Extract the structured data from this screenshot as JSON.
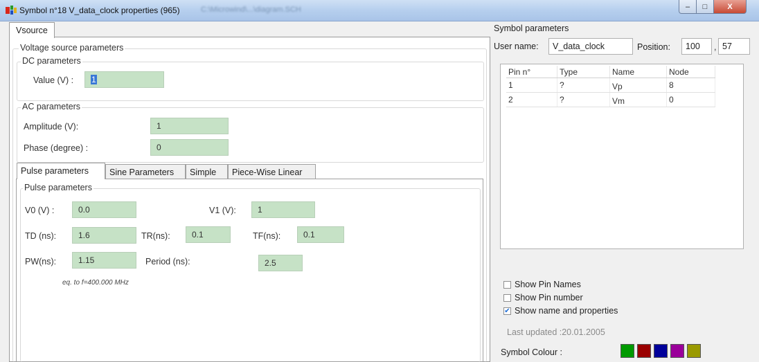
{
  "window": {
    "title": "Symbol n°18 V_data_clock properties (965)",
    "title_blurred_suffix": "C:\\Microwind\\...\\diagram.SCH",
    "min": "–",
    "max": "□",
    "close": "X"
  },
  "tabs": {
    "main": "Vsource"
  },
  "voltage_group": {
    "title": "Voltage source parameters"
  },
  "dc": {
    "title": "DC parameters",
    "value_label": "Value (V) :",
    "value": "1"
  },
  "ac": {
    "title": "AC parameters",
    "amplitude_label": "Amplitude (V):",
    "amplitude": "1",
    "phase_label": "Phase (degree) :",
    "phase": "0"
  },
  "subtabs": [
    "Pulse parameters",
    "Sine Parameters",
    "Simple",
    "Piece-Wise Linear"
  ],
  "pulse": {
    "title": "Pulse parameters",
    "v0_label": "V0 (V) :",
    "v0": "0.0",
    "v1_label": "V1 (V):",
    "v1": "1",
    "td_label": "TD (ns):",
    "td": "1.6",
    "tr_label": "TR(ns):",
    "tr": "0.1",
    "tf_label": "TF(ns):",
    "tf": "0.1",
    "pw_label": "PW(ns):",
    "pw": "1.15",
    "period_label": "Period (ns):",
    "period": "2.5",
    "freq_note": "eq. to f=400.000 MHz"
  },
  "symbol": {
    "title": "Symbol parameters",
    "username_label": "User name:",
    "username": "V_data_clock",
    "position_label": "Position:",
    "pos_x": "100",
    "pos_sep": ",",
    "pos_y": "57"
  },
  "pins": {
    "headers": [
      "Pin n°",
      "Type",
      "Name",
      "Node"
    ],
    "rows": [
      [
        "1",
        "?",
        "Vp",
        "8"
      ],
      [
        "2",
        "?",
        "Vm",
        "0"
      ]
    ]
  },
  "options": {
    "show_pin_names": "Show Pin Names",
    "show_pin_number": "Show Pin number",
    "show_name_props": "Show name and properties",
    "checked": [
      false,
      false,
      true
    ]
  },
  "last_updated": "Last updated :20.01.2005",
  "colour": {
    "label": "Symbol Colour :",
    "swatches": [
      "#009a00",
      "#9a0000",
      "#00009a",
      "#9a009a",
      "#9a9a00"
    ]
  }
}
